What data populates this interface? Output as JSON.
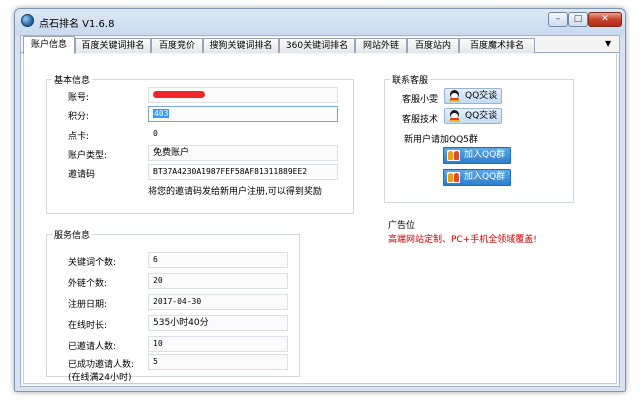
{
  "window": {
    "title": "点石排名 V1.6.8",
    "minimize": "–",
    "maximize": "□",
    "close": "✕"
  },
  "tabs": [
    {
      "label": "账户信息",
      "active": true
    },
    {
      "label": "百度关键词排名"
    },
    {
      "label": "百度竞价"
    },
    {
      "label": "搜狗关键词排名"
    },
    {
      "label": "360关键词排名"
    },
    {
      "label": "网站外链"
    },
    {
      "label": "百度站内"
    },
    {
      "label": "百度魔术排名"
    }
  ],
  "tab_overflow": "▼",
  "basic": {
    "title": "基本信息",
    "account_label": "账号:",
    "points_label": "积分:",
    "points_value": "403",
    "card_label": "点卡:",
    "card_value": "0",
    "type_label": "账户类型:",
    "type_value": "免费账户",
    "invite_label": "邀请码",
    "invite_value": "BT37A4230A1987FEF58AF81311889EE2",
    "invite_note": "将您的邀请码发给新用户注册,可以得到奖励"
  },
  "service": {
    "title": "服务信息",
    "rows": [
      {
        "label": "关键词个数:",
        "value": "6"
      },
      {
        "label": "外链个数:",
        "value": "20"
      },
      {
        "label": "注册日期:",
        "value": "2017-04-30"
      },
      {
        "label": "在线时长:",
        "value": "535小时40分"
      },
      {
        "label": "已邀请人数:",
        "value": "10"
      },
      {
        "label": "已成功邀请人数:",
        "value": "5"
      }
    ],
    "note": "(在线满24小时)"
  },
  "contact": {
    "title": "联系客服",
    "sales_label": "客服小雯",
    "tech_label": "客服技术",
    "qq_button": "QQ交谈",
    "group_note": "新用户请加QQ5群",
    "join_group": "加入QQ群"
  },
  "ad": {
    "title": "广告位",
    "text": "高端网站定制、PC+手机全领域覆盖!",
    "color": "#cc0000"
  },
  "colors": {
    "accent": "#2d7fcd",
    "selection": "#3399ff",
    "redaction": "#f0262a"
  }
}
